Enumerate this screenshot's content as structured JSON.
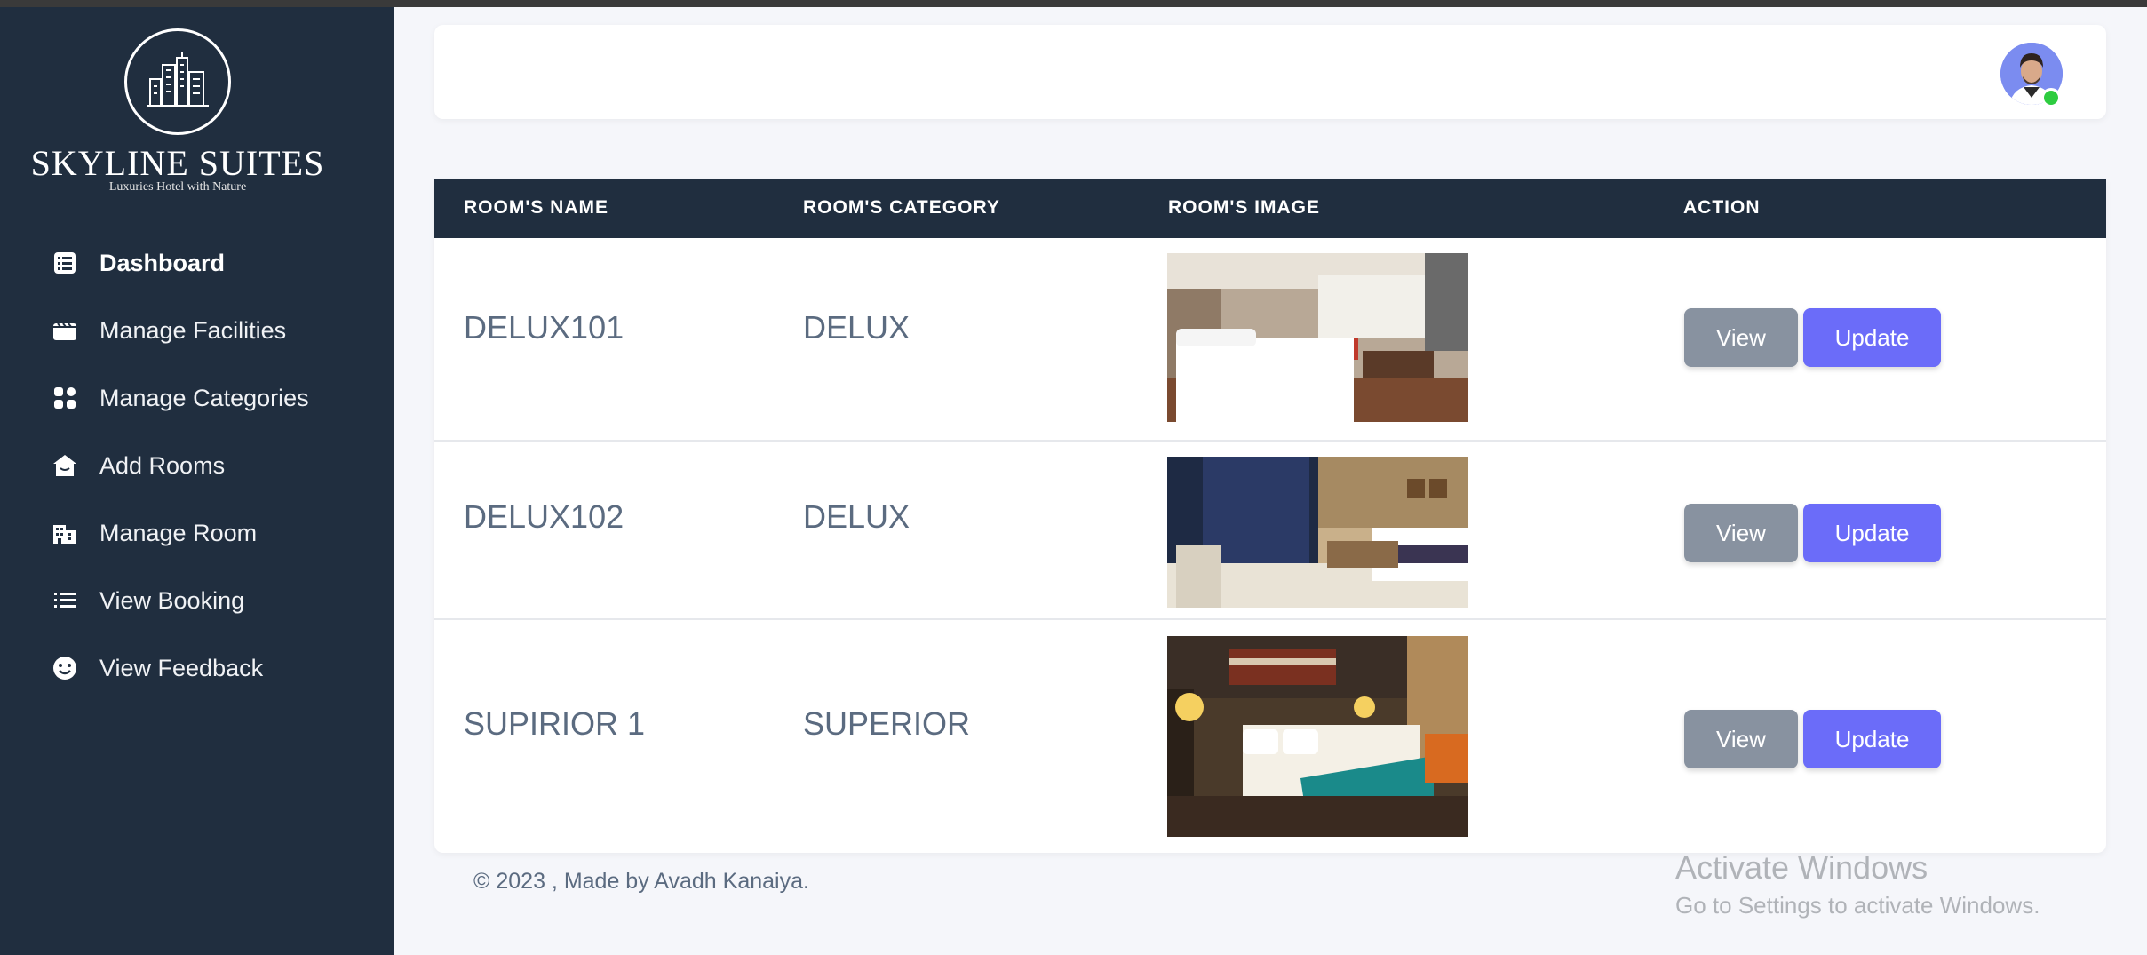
{
  "brand": {
    "name": "SKYLINE SUITES",
    "tagline": "Luxuries Hotel with Nature"
  },
  "sidebar": {
    "items": [
      {
        "label": "Dashboard",
        "icon": "list-icon",
        "active": true
      },
      {
        "label": "Manage Facilities",
        "icon": "clapperboard-icon"
      },
      {
        "label": "Manage Categories",
        "icon": "grid-icon"
      },
      {
        "label": "Add Rooms",
        "icon": "home-icon"
      },
      {
        "label": "Manage Room",
        "icon": "building-icon"
      },
      {
        "label": "View Booking",
        "icon": "list-bullets-icon"
      },
      {
        "label": "View Feedback",
        "icon": "smiley-icon"
      }
    ]
  },
  "table": {
    "headers": [
      "ROOM'S NAME",
      "ROOM'S CATEGORY",
      "ROOM'S IMAGE",
      "ACTION"
    ],
    "rows": [
      {
        "name": "DELUX101",
        "category": "DELUX",
        "view_label": "View",
        "update_label": "Update"
      },
      {
        "name": "DELUX102",
        "category": "DELUX",
        "view_label": "View",
        "update_label": "Update"
      },
      {
        "name": "SUPIRIOR 1",
        "category": "SUPERIOR",
        "view_label": "View",
        "update_label": "Update"
      }
    ]
  },
  "footer": {
    "text": "© 2023 , Made by Avadh Kanaiya."
  },
  "watermark": {
    "title": "Activate Windows",
    "subtitle": "Go to Settings to activate Windows."
  },
  "colors": {
    "sidebar_bg": "#202e3f",
    "update_button": "#6b6cf9",
    "view_button": "#8892a0",
    "online_status": "#2ecc40"
  }
}
